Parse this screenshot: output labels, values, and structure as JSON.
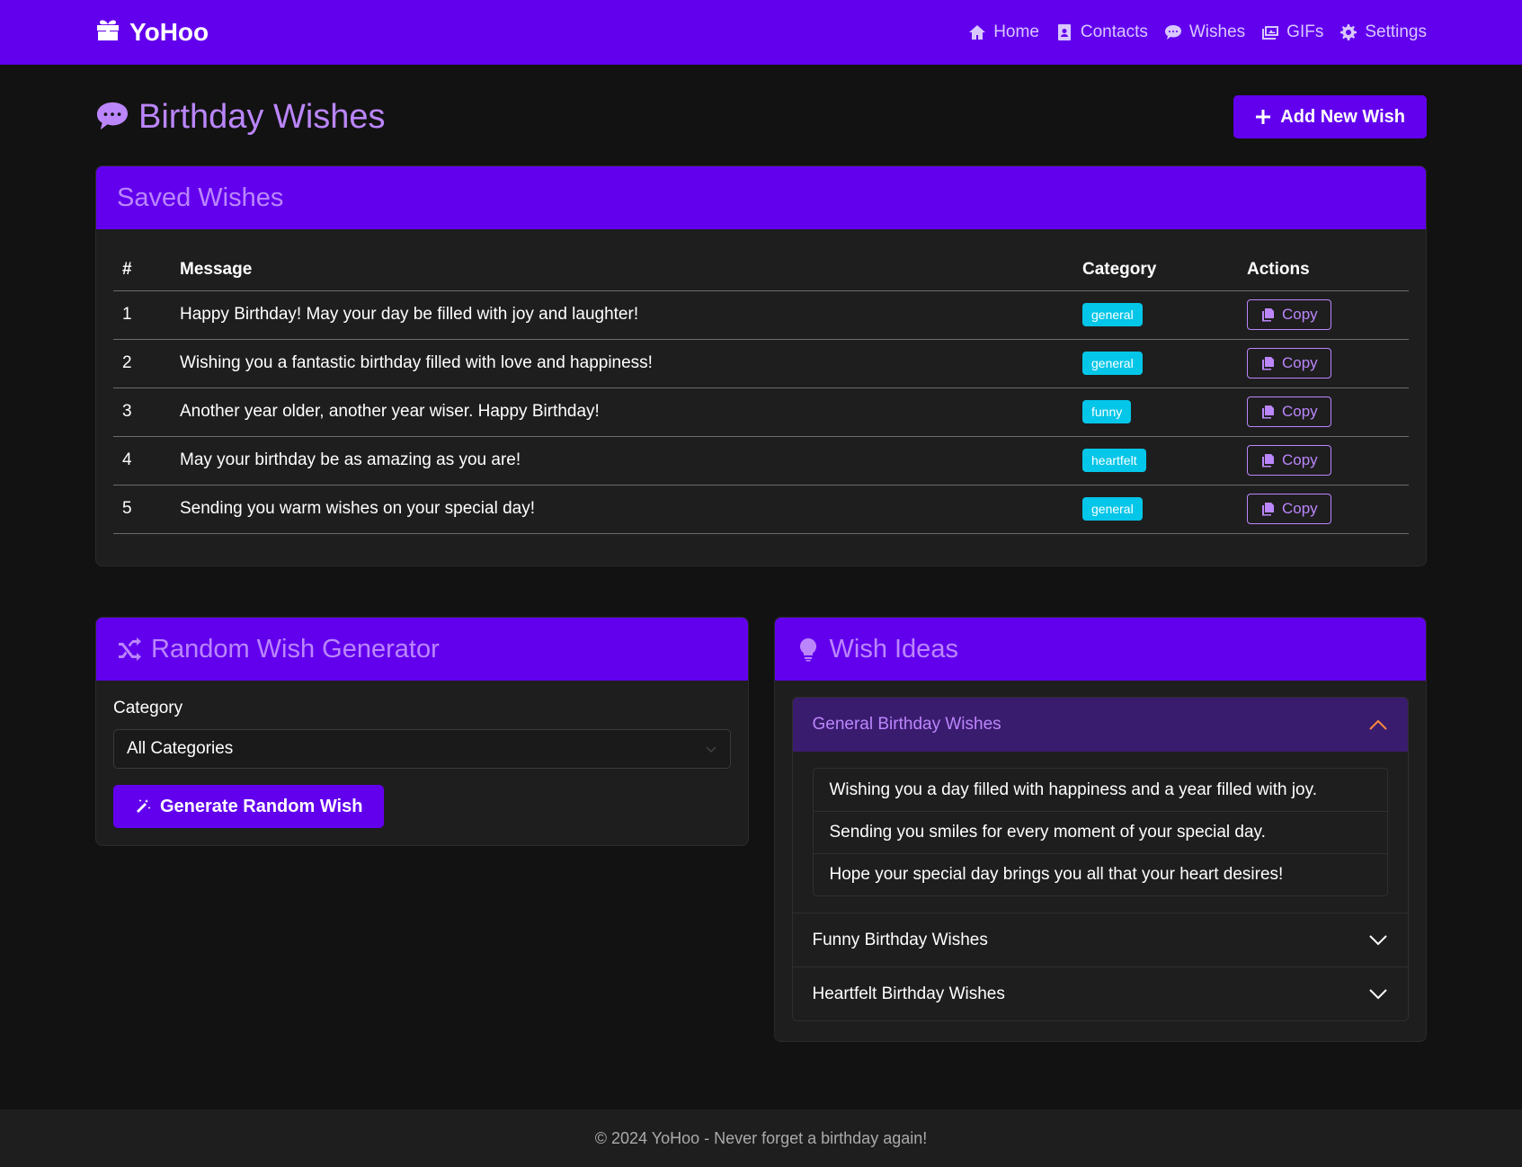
{
  "nav": {
    "brand": "YoHoo",
    "links": [
      {
        "label": "Home",
        "icon": "home-icon"
      },
      {
        "label": "Contacts",
        "icon": "contacts-icon"
      },
      {
        "label": "Wishes",
        "icon": "comment-icon"
      },
      {
        "label": "GIFs",
        "icon": "images-icon"
      },
      {
        "label": "Settings",
        "icon": "gear-icon"
      }
    ]
  },
  "page": {
    "title": "Birthday Wishes",
    "add_button": "Add New Wish"
  },
  "saved": {
    "title": "Saved Wishes",
    "columns": [
      "#",
      "Message",
      "Category",
      "Actions"
    ],
    "copy_label": "Copy",
    "rows": [
      {
        "num": "1",
        "message": "Happy Birthday! May your day be filled with joy and laughter!",
        "category": "general"
      },
      {
        "num": "2",
        "message": "Wishing you a fantastic birthday filled with love and happiness!",
        "category": "general"
      },
      {
        "num": "3",
        "message": "Another year older, another year wiser. Happy Birthday!",
        "category": "funny"
      },
      {
        "num": "4",
        "message": "May your birthday be as amazing as you are!",
        "category": "heartfelt"
      },
      {
        "num": "5",
        "message": "Sending you warm wishes on your special day!",
        "category": "general"
      }
    ]
  },
  "generator": {
    "title": "Random Wish Generator",
    "category_label": "Category",
    "selected": "All Categories",
    "button": "Generate Random Wish"
  },
  "ideas": {
    "title": "Wish Ideas",
    "sections": [
      {
        "title": "General Birthday Wishes",
        "expanded": true,
        "items": [
          "Wishing you a day filled with happiness and a year filled with joy.",
          "Sending you smiles for every moment of your special day.",
          "Hope your special day brings you all that your heart desires!"
        ]
      },
      {
        "title": "Funny Birthday Wishes",
        "expanded": false
      },
      {
        "title": "Heartfelt Birthday Wishes",
        "expanded": false
      }
    ]
  },
  "footer": {
    "text": "© 2024 YoHoo - Never forget a birthday again!"
  },
  "colors": {
    "primary": "#6200ee",
    "accent": "#bb86fc",
    "badge": "#03c6e8",
    "background": "#121212",
    "surface": "#1e1e1e"
  }
}
